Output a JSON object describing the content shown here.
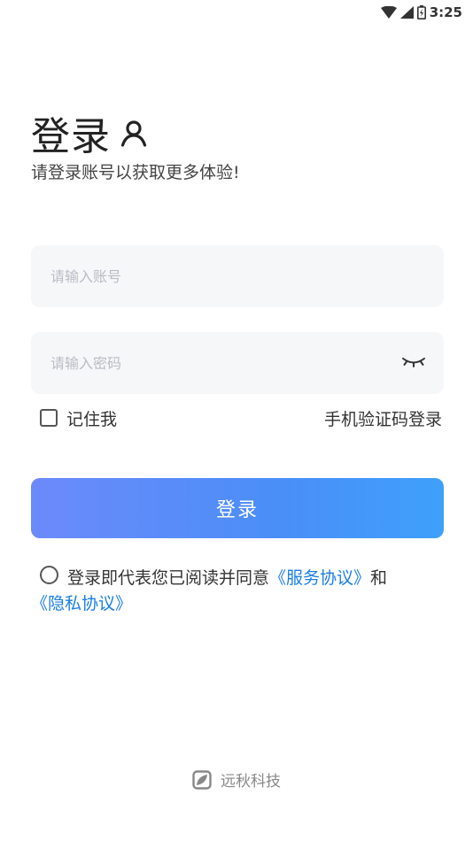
{
  "status_bar": {
    "time": "3:25"
  },
  "header": {
    "title": "登录",
    "subtitle": "请登录账号以获取更多体验!"
  },
  "form": {
    "account_placeholder": "请输入账号",
    "password_placeholder": "请输入密码",
    "remember_label": "记住我",
    "sms_login_label": "手机验证码登录",
    "login_button_label": "登录"
  },
  "agreement": {
    "prefix": "登录即代表您已阅读并同意",
    "service_link": "《服务协议》",
    "and": "和",
    "privacy_link": "《隐私协议》"
  },
  "footer": {
    "brand": "远秋科技"
  },
  "colors": {
    "accent_start": "#6c8afa",
    "accent_end": "#3fa0fb",
    "link": "#1a7ee6",
    "field_bg": "#f6f7f9"
  }
}
